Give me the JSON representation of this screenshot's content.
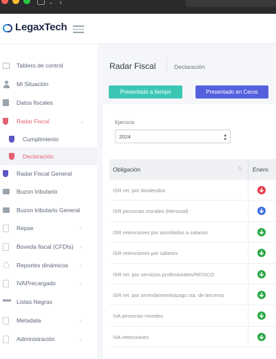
{
  "app": {
    "logo_text": "LegaxTech"
  },
  "colors": {
    "teal_button": "#3cc7b5",
    "blue_button": "#5460dd",
    "active_nav": "#e36276",
    "status_red": "#e5394a",
    "status_blue": "#3b6fe0",
    "status_green": "#27a844"
  },
  "sidebar": {
    "items": [
      {
        "label": "Tablero de control",
        "icon": "monitor-icon"
      },
      {
        "label": "Mi Situación",
        "icon": "user-icon"
      },
      {
        "label": "Datos fiscales",
        "icon": "id-card-icon"
      },
      {
        "label": "Radar Fiscal",
        "icon": "shield-icon",
        "caret": "⌄"
      },
      {
        "label": "Cumplimiento",
        "icon": "shield-icon"
      },
      {
        "label": "Declaración",
        "icon": "shield-icon"
      },
      {
        "label": "Radar Fiscal General",
        "icon": "shield-icon"
      },
      {
        "label": "Buzon tributario",
        "icon": "mail-icon"
      },
      {
        "label": "Buzon tributario General",
        "icon": "mail-icon"
      },
      {
        "label": "Repse",
        "icon": "document-icon",
        "caret": "›"
      },
      {
        "label": "Boveda fiscal (CFDIs)",
        "icon": "folder-icon",
        "caret": "›"
      },
      {
        "label": "Reportes dinámicos",
        "icon": "gear-icon",
        "caret": "›"
      },
      {
        "label": "IVAPrecargado",
        "icon": "list-icon",
        "caret": "›"
      },
      {
        "label": "Listas Negras",
        "icon": "users-icon"
      },
      {
        "label": "Metadata",
        "icon": "file-icon",
        "caret": "›"
      },
      {
        "label": "Administración",
        "icon": "list-icon",
        "caret": "›"
      }
    ]
  },
  "header": {
    "title": "Radar Fiscal",
    "breadcrumb": "Declaración"
  },
  "actions": {
    "presented_on_time": "Presentado a tiempo",
    "presented_zero": "Presentado en Ceros"
  },
  "filter": {
    "label": "Ejercicio",
    "selected": "2024"
  },
  "table": {
    "col_obligation": "Obligación",
    "col_month": "Enero",
    "rows": [
      {
        "label": "ISR ret. por dividendos",
        "status": "red"
      },
      {
        "label": "ISR personas morales (Mensual)",
        "status": "blue"
      },
      {
        "label": "ISR retenciones por asimilados a salarios",
        "status": "green"
      },
      {
        "label": "ISR retenciones por salarios",
        "status": "green"
      },
      {
        "label": "ISR ret. por servicios profesionales/RESICO",
        "status": "green"
      },
      {
        "label": "ISR ret. por arrendamiento/pago cta. de terceros",
        "status": "green"
      },
      {
        "label": "IVA personas morales",
        "status": "green"
      },
      {
        "label": "IVA retenciones",
        "status": "green"
      }
    ]
  }
}
